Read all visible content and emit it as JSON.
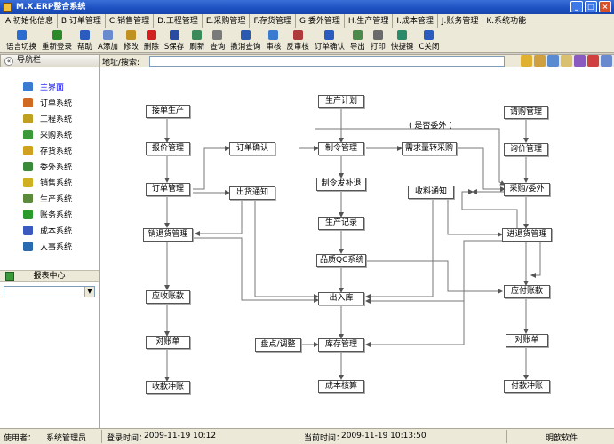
{
  "window": {
    "title": "M.X.ERP整合系统"
  },
  "menu": [
    "A.初始化信息",
    "B.订单管理",
    "C.销售管理",
    "D.工程管理",
    "E.采购管理",
    "F.存货管理",
    "G.委外管理",
    "H.生产管理",
    "I.成本管理",
    "J.账务管理",
    "K.系统功能"
  ],
  "toolbar": [
    {
      "label": "语言切换",
      "icon": "globe-icon",
      "color": "#2a6cd0"
    },
    {
      "label": "重新登录",
      "icon": "login-icon",
      "color": "#2a8a2a"
    },
    {
      "label": "帮助",
      "icon": "help-icon",
      "color": "#2a5cc0"
    },
    {
      "label": "A添加",
      "icon": "add-icon",
      "color": "#6a8ad0"
    },
    {
      "label": "修改",
      "icon": "edit-icon",
      "color": "#c09020"
    },
    {
      "label": "删除",
      "icon": "delete-icon",
      "color": "#d02020"
    },
    {
      "label": "S保存",
      "icon": "save-icon",
      "color": "#2a4ca0"
    },
    {
      "label": "刷新",
      "icon": "refresh-icon",
      "color": "#3a8a5a"
    },
    {
      "label": "查询",
      "icon": "query-icon",
      "color": "#7a7a7a"
    },
    {
      "label": "撤消查询",
      "icon": "undo-query-icon",
      "color": "#2a5ab0"
    },
    {
      "label": "审核",
      "icon": "approve-icon",
      "color": "#3a7ad0"
    },
    {
      "label": "反审核",
      "icon": "unapprove-icon",
      "color": "#b03a3a"
    },
    {
      "label": "订单确认",
      "icon": "confirm-icon",
      "color": "#2a5cc0"
    },
    {
      "label": "导出",
      "icon": "export-icon",
      "color": "#4a8a4a"
    },
    {
      "label": "打印",
      "icon": "print-icon",
      "color": "#6a6a6a"
    },
    {
      "label": "快捷键",
      "icon": "shortcut-icon",
      "color": "#2a8a6a"
    },
    {
      "label": "C关闭",
      "icon": "close-doc-icon",
      "color": "#2a5cc0"
    }
  ],
  "nav": {
    "header": "导航栏"
  },
  "address": {
    "label": "地址/搜索:",
    "value": ""
  },
  "sidebar": {
    "items": [
      {
        "label": "主界面",
        "color": "#3a7ad0",
        "active": true
      },
      {
        "label": "订单系统",
        "color": "#d06a20"
      },
      {
        "label": "工程系统",
        "color": "#c0a020"
      },
      {
        "label": "采购系统",
        "color": "#3a9a3a"
      },
      {
        "label": "存货系统",
        "color": "#d0a020"
      },
      {
        "label": "委外系统",
        "color": "#3a8a3a"
      },
      {
        "label": "销售系统",
        "color": "#d0b020"
      },
      {
        "label": "生产系统",
        "color": "#5a8a3a"
      },
      {
        "label": "账务系统",
        "color": "#2a9a2a"
      },
      {
        "label": "成本系统",
        "color": "#3a5ac0"
      },
      {
        "label": "人事系统",
        "color": "#2a6ab0"
      }
    ],
    "report": "报表中心",
    "select_value": ""
  },
  "flow": {
    "nodes": {
      "n1": "接单生产",
      "n2": "报价管理",
      "n3": "订单管理",
      "n4": "销退货管理",
      "n5": "应收账款",
      "n6": "对账单",
      "n7": "收款冲账",
      "n8": "订单确认",
      "n9": "出货通知",
      "n10": "生产计划",
      "n11": "制令管理",
      "n12": "制令发补退",
      "n13": "生产记录",
      "n14": "品质QC系统",
      "n15": "出入库",
      "n16": "盘点/调整",
      "n17": "库存管理",
      "n18": "成本核算",
      "n19": "需求量转采购",
      "n20": "收料通知",
      "n21": "请购管理",
      "n22": "询价管理",
      "n23": "采购/委外",
      "n24": "进退货管理",
      "n25": "应付账款",
      "n26": "对账单",
      "n27": "付款冲账"
    },
    "label_outsource": "( 是否委外 )"
  },
  "status": {
    "user_label": "使用者：",
    "user": "系统管理员",
    "login_label": "登录时间：",
    "login_time": "2009-11-19 10:12",
    "now_label": "当前时间：",
    "now_time": "2009-11-19 10:13:50",
    "company": "明歆软件"
  }
}
